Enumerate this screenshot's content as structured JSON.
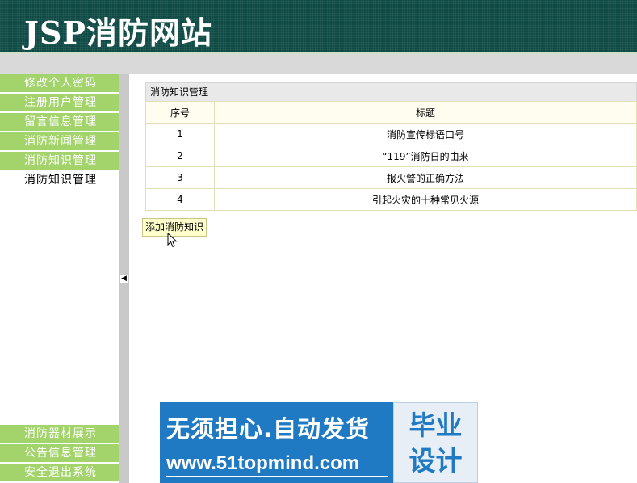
{
  "header": {
    "title": "JSP消防网站"
  },
  "sidebar": {
    "top_items": [
      {
        "label": "修改个人密码"
      },
      {
        "label": "注册用户管理"
      },
      {
        "label": "留言信息管理"
      },
      {
        "label": "消防新闻管理"
      },
      {
        "label": "消防知识管理"
      }
    ],
    "sub_item": {
      "label": "消防知识管理"
    },
    "bottom_items": [
      {
        "label": "消防器材展示"
      },
      {
        "label": "公告信息管理"
      },
      {
        "label": "安全退出系统"
      }
    ]
  },
  "panel": {
    "title": "消防知识管理",
    "columns": [
      "序号",
      "标题"
    ],
    "rows": [
      {
        "index": "1",
        "title": "消防宣传标语口号"
      },
      {
        "index": "2",
        "title": "“119”消防日的由来"
      },
      {
        "index": "3",
        "title": "报火警的正确方法"
      },
      {
        "index": "4",
        "title": "引起火灾的十种常见火源"
      }
    ],
    "add_button": "添加消防知识"
  },
  "banner": {
    "line1": "无须担心.自动发货",
    "line2": "www.51topmind.com",
    "badge_line1": "毕业",
    "badge_line2": "设计"
  }
}
